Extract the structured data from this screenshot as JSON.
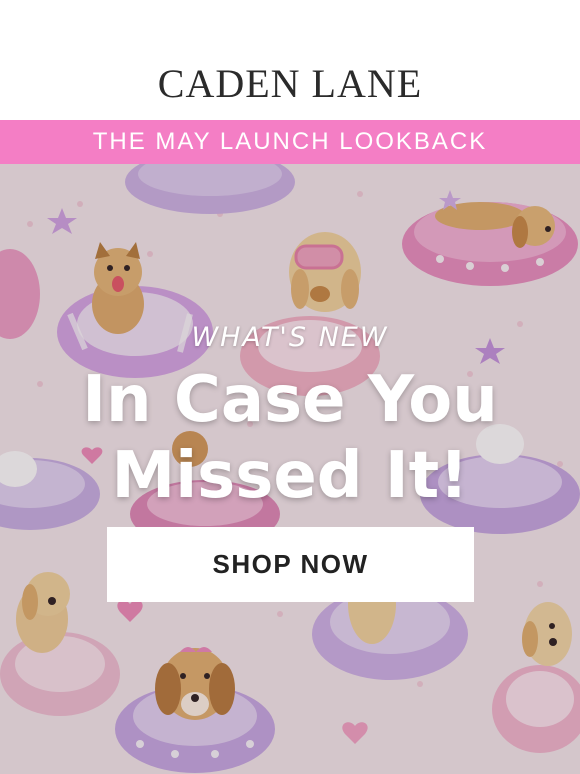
{
  "brand": {
    "name": "CADEN LANE"
  },
  "banner": {
    "text": "THE MAY LAUNCH LOOKBACK"
  },
  "hero": {
    "eyebrow": "WHAT'S NEW",
    "headline_line1": "In Case You",
    "headline_line2": "Missed It!",
    "cta_label": "SHOP NOW"
  },
  "colors": {
    "banner_bg": "#f47ec5",
    "logo_text": "#2b2b2b",
    "hero_bg": "#f6e8ec",
    "cta_bg": "#ffffff",
    "cta_text": "#222222"
  }
}
